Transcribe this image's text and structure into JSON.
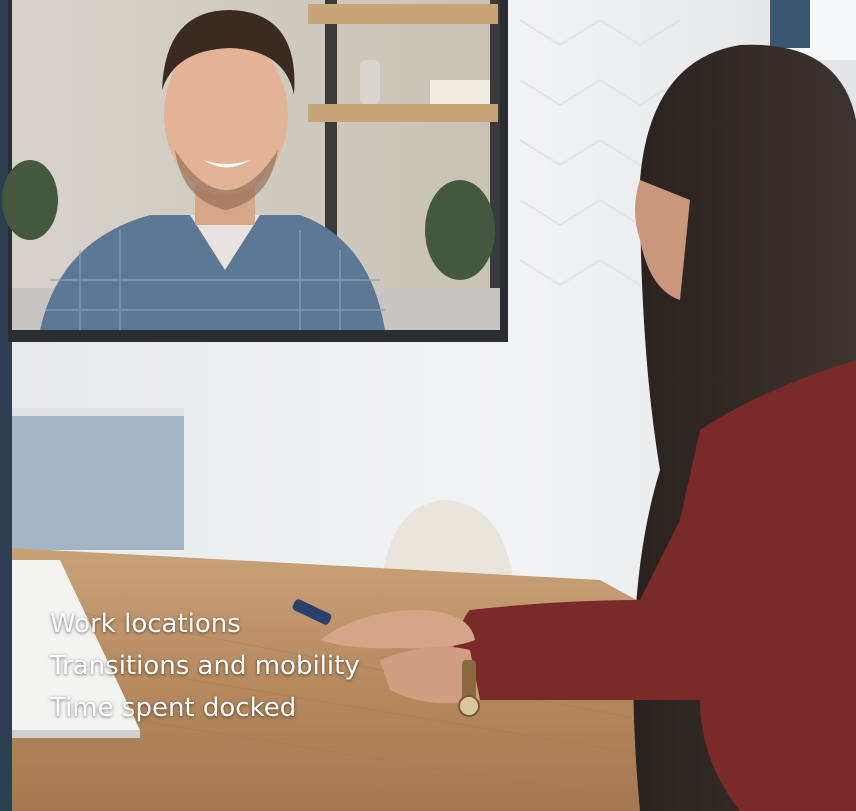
{
  "overlay": {
    "lines": [
      "Work locations",
      "Transitions and mobility",
      "Time spent docked"
    ]
  }
}
